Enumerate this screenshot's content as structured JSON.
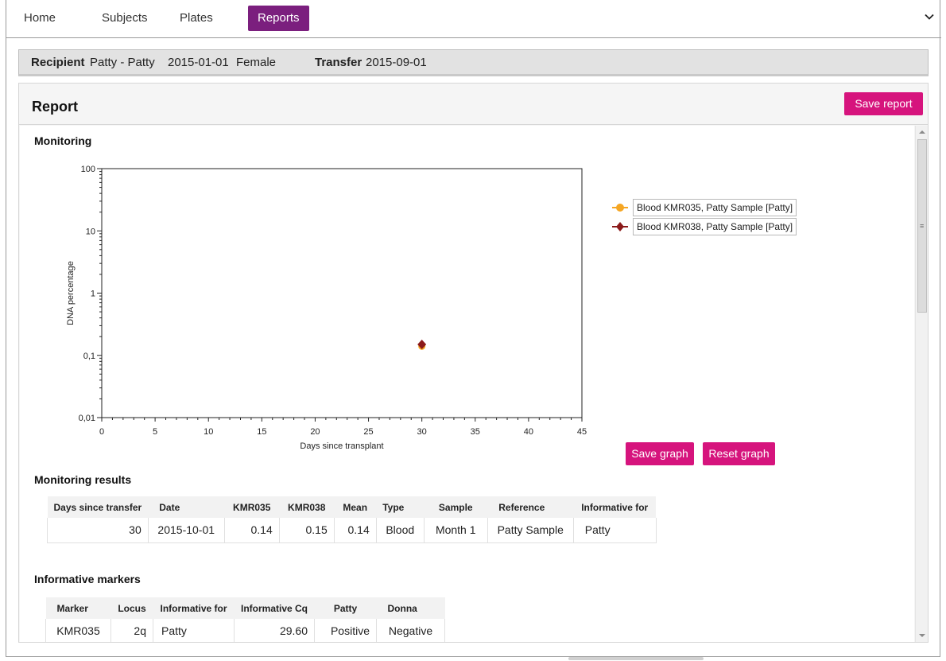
{
  "nav": {
    "items": [
      {
        "label": "Home"
      },
      {
        "label": "Subjects"
      },
      {
        "label": "Plates"
      },
      {
        "label": "Reports"
      }
    ],
    "active_color": "#7b1f7e"
  },
  "recipient": {
    "recipient_label": "Recipient",
    "name": "Patty - Patty",
    "birth_date": "2015-01-01",
    "sex": "Female",
    "transfer_label": "Transfer",
    "transfer_date": "2015-09-01"
  },
  "report": {
    "title": "Report",
    "save_report_label": "Save report",
    "accent_color": "#d6147d"
  },
  "monitoring": {
    "title": "Monitoring",
    "save_graph_label": "Save graph",
    "reset_graph_label": "Reset graph"
  },
  "chart_data": {
    "type": "scatter",
    "xlabel": "Days since transplant",
    "ylabel": "DNA percentage",
    "xlim": [
      0,
      45
    ],
    "ylim": [
      0.01,
      100
    ],
    "y_scale": "log",
    "x_ticks": [
      0,
      5,
      10,
      15,
      20,
      25,
      30,
      35,
      40,
      45
    ],
    "y_ticks": [
      "0,01",
      "0,1",
      "1",
      "10",
      "100"
    ],
    "grid": false,
    "legend_position": "right",
    "series": [
      {
        "name": "Blood KMR035, Patty Sample [Patty]",
        "color": "#f5a623",
        "marker": "circle",
        "points": [
          {
            "x": 30,
            "y": 0.14
          }
        ]
      },
      {
        "name": "Blood KMR038, Patty Sample [Patty]",
        "color": "#8b1a1a",
        "marker": "diamond",
        "points": [
          {
            "x": 30,
            "y": 0.15
          }
        ]
      }
    ]
  },
  "monitoring_results": {
    "title": "Monitoring results",
    "headers": [
      "Days since transfer",
      "Date",
      "KMR035",
      "KMR038",
      "Mean",
      "Type",
      "Sample",
      "Reference",
      "Informative for"
    ],
    "rows": [
      [
        "30",
        "2015-10-01",
        "0.14",
        "0.15",
        "0.14",
        "Blood",
        "Month 1",
        "Patty Sample",
        "Patty"
      ]
    ]
  },
  "informative_markers": {
    "title": "Informative markers",
    "headers": [
      "Marker",
      "Locus",
      "Informative for",
      "Informative Cq",
      "Patty",
      "Donna"
    ],
    "rows": [
      [
        "KMR035",
        "2q",
        "Patty",
        "29.60",
        "Positive",
        "Negative"
      ]
    ]
  }
}
